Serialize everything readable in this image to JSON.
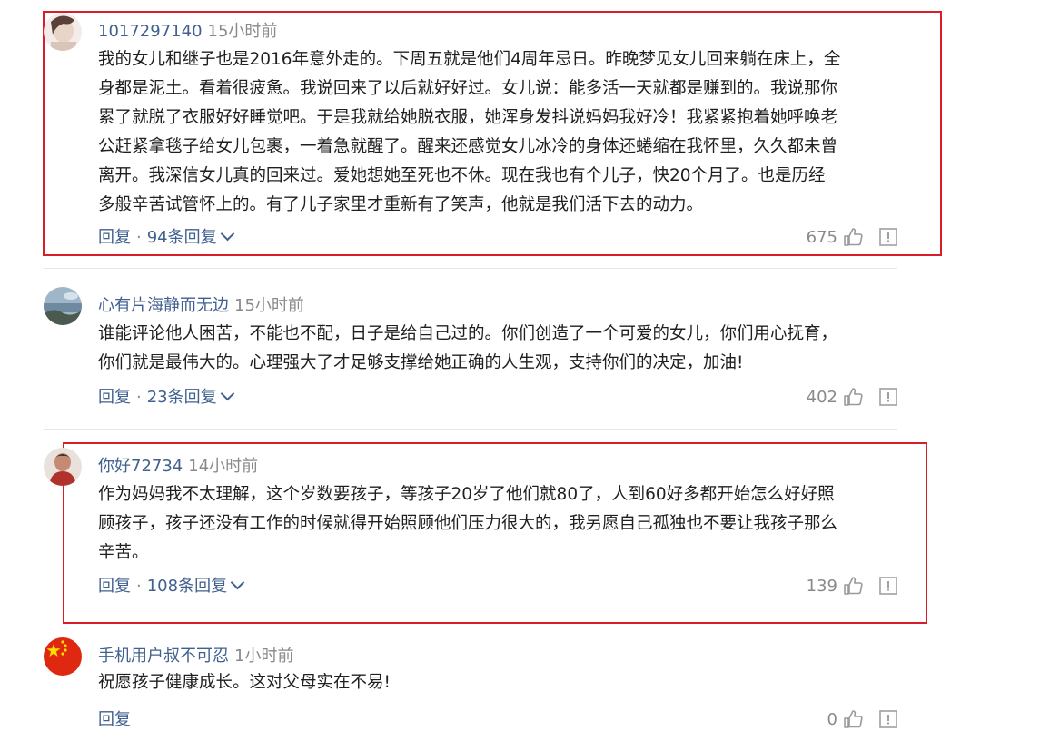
{
  "comments": [
    {
      "user": "1017297140",
      "time": "15小时前",
      "text": [
        "我的女儿和继子也是2016年意外走的。下周五就是他们4周年忌日。昨晚梦见女儿回来躺在床上，全",
        "身都是泥土。看着很疲惫。我说回来了以后就好好过。女儿说：能多活一天就都是赚到的。我说那你",
        "累了就脱了衣服好好睡觉吧。于是我就给她脱衣服，她浑身发抖说妈妈我好冷！我紧紧抱着她呼唤老",
        "公赶紧拿毯子给女儿包裹，一着急就醒了。醒来还感觉女儿冰冷的身体还蜷缩在我怀里，久久都未曾",
        "离开。我深信女儿真的回来过。爱她想她至死也不休。现在我也有个儿子，快20个月了。也是历经",
        "多般辛苦试管怀上的。有了儿子家里才重新有了笑声，他就是我们活下去的动力。"
      ],
      "reply_label": "回复",
      "replies_label": "94条回复",
      "likes": "675"
    },
    {
      "user": "心有片海静而无边",
      "time": "15小时前",
      "text": [
        "谁能评论他人困苦，不能也不配，日子是给自己过的。你们创造了一个可爱的女儿，你们用心抚育，",
        "你们就是最伟大的。心理强大了才足够支撑给她正确的人生观，支持你们的决定，加油!"
      ],
      "reply_label": "回复",
      "replies_label": "23条回复",
      "likes": "402"
    },
    {
      "user": "你好72734",
      "time": "14小时前",
      "text": [
        "作为妈妈我不太理解，这个岁数要孩子，等孩子20岁了他们就80了，人到60好多都开始怎么好好照",
        "顾孩子，孩子还没有工作的时候就得开始照顾他们压力很大的，我另愿自己孤独也不要让我孩子那么",
        "辛苦。"
      ],
      "reply_label": "回复",
      "replies_label": "108条回复",
      "likes": "139"
    },
    {
      "user": "手机用户叔不可忍",
      "time": "1小时前",
      "text": [
        "祝愿孩子健康成长。这对父母实在不易!"
      ],
      "reply_label": "回复",
      "likes": "0"
    }
  ],
  "colors": {
    "username": "#40608f",
    "highlight": "#d81e28",
    "meta": "#8a8a8a"
  }
}
